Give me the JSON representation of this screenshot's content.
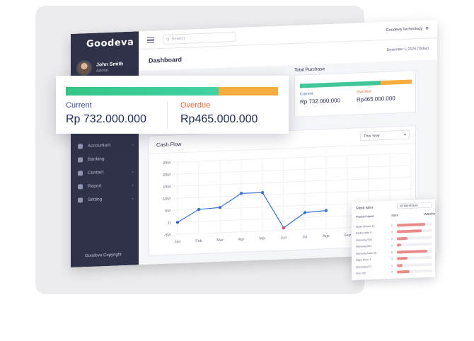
{
  "app": {
    "logo": "Goodeva"
  },
  "user": {
    "name": "John Smith",
    "role": "Admin"
  },
  "search": {
    "placeholder": "Search"
  },
  "topbar": {
    "company": "Goodeva Technology"
  },
  "page": {
    "title": "Dashboard",
    "date": "Desember 1, 2020 (Today)"
  },
  "sidebar": {
    "items": [
      {
        "label": "Accountant",
        "icon": "accountant-icon",
        "has_chevron": true
      },
      {
        "label": "Banking",
        "icon": "bank-icon",
        "has_chevron": false
      },
      {
        "label": "Contact",
        "icon": "contact-icon",
        "has_chevron": true
      },
      {
        "label": "Report",
        "icon": "report-icon",
        "has_chevron": true
      },
      {
        "label": "Setting",
        "icon": "gear-icon",
        "has_chevron": true
      }
    ],
    "copyright": "Goodeva Copyright"
  },
  "receivable": {
    "current_label": "Current",
    "current_value": "Rp 732.000.000",
    "overdue_label": "Overdue",
    "overdue_value": "Rp465.000.000",
    "current_fraction": 0.72
  },
  "purchase": {
    "title": "Total Purchase",
    "current_label": "Current",
    "current_value": "Rp 732.000.000",
    "overdue_label": "Overdue",
    "overdue_value": "Rp465.000.000",
    "current_fraction": 0.72
  },
  "cashflow": {
    "title": "Cash Flow",
    "period": "This Year",
    "colors": {
      "line": "#3a6fd8",
      "negative_point": "#e2485a"
    }
  },
  "chart_data": {
    "type": "line",
    "title": "Cash Flow",
    "categories": [
      "Jan",
      "Feb",
      "Mar",
      "Apr",
      "Mei",
      "Jun",
      "Jul",
      "Ags",
      "Sep"
    ],
    "series": [
      {
        "values": [
          0,
          5,
          5.5,
          11,
          11,
          -4,
          2,
          2.5,
          7
        ]
      }
    ],
    "y_ticks": [
      "25M",
      "20M",
      "15M",
      "10M",
      "5M",
      "0",
      "-5M"
    ],
    "ylim": [
      -5,
      25
    ],
    "grid": true
  },
  "stock": {
    "title": "Stock Alert",
    "selector": "All Warehouse",
    "headers": [
      "Product Name",
      "Stock"
    ],
    "clipped_header": "Wareho",
    "rows": [
      {
        "name": "Apple iPhone 12",
        "qty": "2",
        "level": 0.8
      },
      {
        "name": "Redmi Note 9",
        "qty": "4",
        "level": 0.7
      },
      {
        "name": "Samsung S20",
        "qty": "2",
        "level": 0.3
      },
      {
        "name": "Samsung A51",
        "qty": "1",
        "level": 0.12
      },
      {
        "name": "Samsung Note 20",
        "qty": "5",
        "level": 0.85
      },
      {
        "name": "Oppo Reno 4",
        "qty": "1",
        "level": 0.3
      },
      {
        "name": "Samsung A71",
        "qty": "1",
        "level": 0.15
      },
      {
        "name": "Vivo Y20",
        "qty": "3",
        "level": 0.35
      }
    ]
  }
}
